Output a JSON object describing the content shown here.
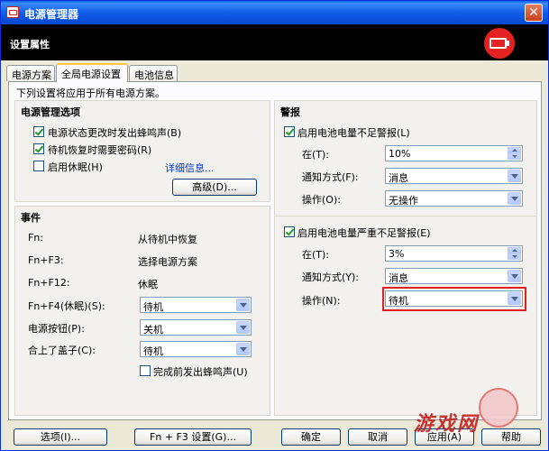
{
  "window": {
    "title": "电源管理器",
    "close_glyph": "✕"
  },
  "header": {
    "title": "设置属性",
    "badge_icon": "battery-charging-icon",
    "badge_color": "#e52222"
  },
  "tabs": [
    {
      "label": "电源方案",
      "active": false
    },
    {
      "label": "全局电源设置",
      "active": true
    },
    {
      "label": "电池信息",
      "active": false
    }
  ],
  "panel_note": "下列设置将应用于所有电源方案。",
  "power_options": {
    "title": "电源管理选项",
    "checkboxes": [
      {
        "label": "电源状态更改时发出蜂鸣声(B)",
        "checked": true
      },
      {
        "label": "待机恢复时需要密码(R)",
        "checked": true
      },
      {
        "label": "启用休眠(H)",
        "checked": false
      }
    ],
    "details_link": "详细信息...",
    "advanced_button": "高级(D)..."
  },
  "events": {
    "title": "事件",
    "rows": [
      {
        "key": "Fn:",
        "value": "从待机中恢复"
      },
      {
        "key": "Fn+F3:",
        "value": "选择电源方案"
      },
      {
        "key": "Fn+F12:",
        "value": "休眠"
      }
    ],
    "selects": [
      {
        "label": "Fn+F4(休眠)(S):",
        "value": "待机"
      },
      {
        "label": "电源按钮(P):",
        "value": "关机"
      },
      {
        "label": "合上了盖子(C):",
        "value": "待机"
      }
    ],
    "beep_checkbox": {
      "label": "完成前发出蜂鸣声(U)",
      "checked": false
    }
  },
  "alarms": {
    "title": "警报",
    "low": {
      "checkbox": {
        "label": "启用电池电量不足警报(L)",
        "checked": true
      },
      "at_label": "在(T):",
      "at_value": "10%",
      "notify_label": "通知方式(F):",
      "notify_value": "消息",
      "action_label": "操作(O):",
      "action_value": "无操作"
    },
    "critical": {
      "checkbox": {
        "label": "启用电池电量严重不足警报(E)",
        "checked": true
      },
      "at_label": "在(T):",
      "at_value": "3%",
      "notify_label": "通知方式(Y):",
      "notify_value": "消息",
      "action_label": "操作(N):",
      "action_value": "待机"
    }
  },
  "buttons": {
    "options": "选项(I)...",
    "fn_f3": "Fn + F3 设置(G)...",
    "ok": "确定",
    "cancel": "取消",
    "apply": "应用(A)",
    "help": "帮助"
  },
  "watermark": {
    "text": "游戏网"
  }
}
